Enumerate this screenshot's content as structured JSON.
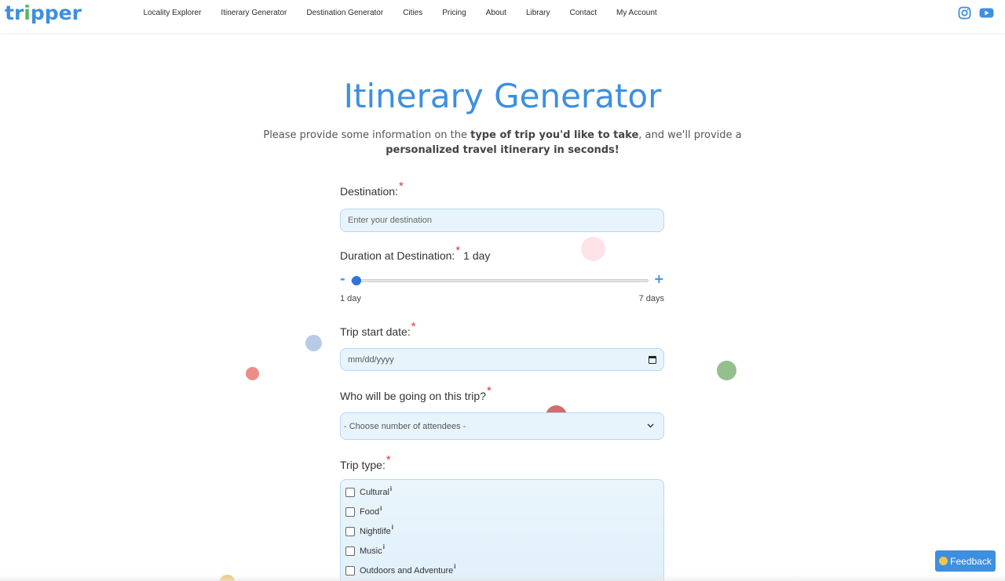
{
  "brand": {
    "logo_text_start": "tr",
    "logo_text_mid": "i",
    "logo_text_end": "pper"
  },
  "nav": {
    "items": [
      {
        "label": "Locality Explorer"
      },
      {
        "label": "Itinerary Generator"
      },
      {
        "label": "Destination Generator"
      },
      {
        "label": "Cities"
      },
      {
        "label": "Pricing"
      },
      {
        "label": "About"
      },
      {
        "label": "Library"
      },
      {
        "label": "Contact"
      },
      {
        "label": "My Account"
      }
    ]
  },
  "social": {
    "instagram_icon": "instagram-icon",
    "youtube_icon": "youtube-icon"
  },
  "hero": {
    "title": "Itinerary Generator",
    "sub_1": "Please provide some information on the ",
    "sub_2": "type of trip you'd like to take",
    "sub_3": ", and we'll provide a ",
    "sub_4": "personalized travel itinerary in seconds!"
  },
  "form": {
    "required_mark": "*",
    "destination": {
      "label": "Destination:",
      "placeholder": "Enter your destination"
    },
    "duration": {
      "label": "Duration at Destination:",
      "value": "1 day",
      "min_label": "1 day",
      "max_label": "7 days",
      "minus": "-",
      "plus": "+",
      "current": 1,
      "min": 1,
      "max": 7
    },
    "start_date": {
      "label": "Trip start date:",
      "placeholder": "mm/dd/yyyy"
    },
    "attendees": {
      "label": "Who will be going on this trip?",
      "selected": "- Choose number of attendees -"
    },
    "trip_type": {
      "label": "Trip type:",
      "info_mark": "i",
      "options": [
        {
          "label": "Cultural"
        },
        {
          "label": "Food"
        },
        {
          "label": "Nightlife"
        },
        {
          "label": "Music"
        },
        {
          "label": "Outdoors and Adventure"
        }
      ]
    }
  },
  "feedback": {
    "label": "Feedback"
  },
  "colors": {
    "accent": "#3d8fe0",
    "required": "#d43a3a",
    "field_bg": "#e8f4fb"
  }
}
